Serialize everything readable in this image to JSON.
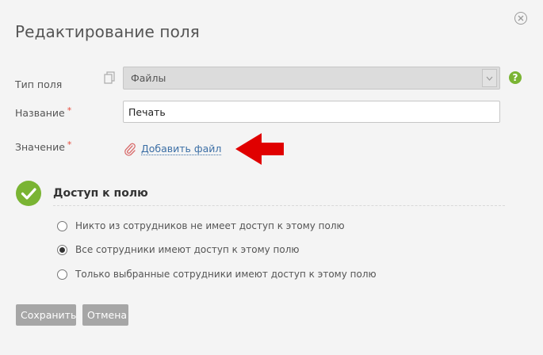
{
  "dialog": {
    "title": "Редактирование поля"
  },
  "form": {
    "field_type": {
      "label": "Тип поля",
      "value": "Файлы"
    },
    "name": {
      "label": "Название",
      "required_mark": "*",
      "value": "Печать"
    },
    "value": {
      "label": "Значение",
      "required_mark": "*",
      "add_file_label": "Добавить файл"
    }
  },
  "access": {
    "title": "Доступ к полю",
    "options": [
      {
        "label": "Никто из сотрудников не имеет доступ к этому полю",
        "selected": false
      },
      {
        "label": "Все сотрудники имеют доступ к этому полю",
        "selected": true
      },
      {
        "label": "Только выбранные сотрудники имеют доступ к этому полю",
        "selected": false
      }
    ]
  },
  "help": {
    "glyph": "?"
  },
  "buttons": {
    "save": "Сохранить",
    "cancel": "Отмена"
  },
  "colors": {
    "accent_green": "#7ab433",
    "link_blue": "#3b6ea5",
    "arrow_red": "#e00000",
    "required_red": "#e74c3c",
    "button_gray": "#a6a6a6"
  },
  "icons": {
    "close": "close-icon",
    "copy": "copy-icon",
    "chevron": "chevron-down-icon",
    "help": "help-icon",
    "clip": "paperclip-icon",
    "arrow": "red-arrow-icon",
    "check": "check-circle-icon"
  }
}
